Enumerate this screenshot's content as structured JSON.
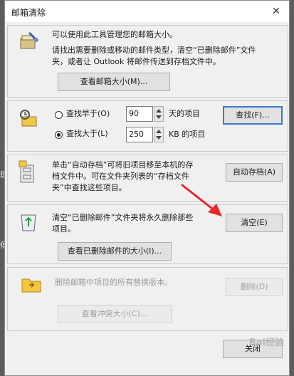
{
  "window": {
    "title": "邮箱清除",
    "close_glyph": "✕"
  },
  "edge_glyphs": [
    "理",
    "傳"
  ],
  "section1": {
    "line1": "可以使用此工具管理您的邮箱大小。",
    "line2": "请找出需要删除或移动的邮件类型，清空“已删除邮件”文件",
    "line3": "夹，或者让 Outlook 将邮件传送到存档文件中。",
    "button": "查看邮箱大小(M)...",
    "icon": "mailbox-cleanup-icon"
  },
  "section2": {
    "radio_older_label": "查找早于(O)",
    "radio_larger_label": "查找大于(L)",
    "older_value": "90",
    "older_unit": "天的项目",
    "larger_value": "250",
    "larger_unit": "KB 的项目",
    "find_button": "查找(F)...",
    "icon": "find-items-icon"
  },
  "section3": {
    "line1": "单击“自动存档”可将旧项目移至本机的存",
    "line2": "档文件中。可在文件夹列表的“存档文件",
    "line3": "夹”中查找这些项目。",
    "button": "自动存档(A)",
    "icon": "archive-cabinet-icon"
  },
  "section4": {
    "line1": "清空“已删除邮件”文件夹将永久删除那些",
    "line2": "项目。",
    "empty_button": "清空(E)",
    "view_button": "查看已删除邮件的大小(I)...",
    "icon": "recycle-bin-icon"
  },
  "section5": {
    "line1": "删除邮箱中项目的所有替换版本。",
    "delete_button": "删除(D)",
    "view_button": "查看冲突大小(C)...",
    "icon": "conflicts-folder-icon"
  },
  "footer": {
    "close_button": "关闭"
  },
  "watermark": "Bai经验",
  "colors": {
    "arrow": "#e8282b",
    "window_bg": "#f0f0f0",
    "button_bg": "#e1e1e1",
    "focus_border": "#3c78c8"
  }
}
